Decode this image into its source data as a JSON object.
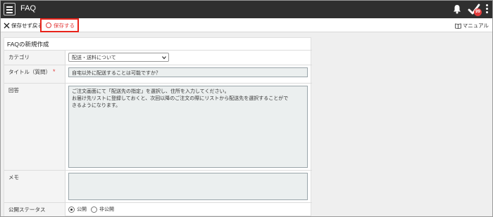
{
  "header": {
    "app_title": "FAQ",
    "badge_count": "99"
  },
  "actions": {
    "back_label": "保存せず戻る",
    "save_label": "保存する",
    "manual_label": "マニュアル"
  },
  "form": {
    "title": "FAQの新規作成",
    "fields": {
      "category": {
        "label": "カテゴリ",
        "value": "配送・送料について"
      },
      "title_question": {
        "label": "タイトル（質問）",
        "required_mark": "*",
        "value": "自宅以外に配送することは可能ですか？"
      },
      "answer": {
        "label": "回答",
        "value": "ご注文画面にて「配送先の指定」を選択し、住所を入力してください。\nお届け先リストに登録しておくと、次回以降のご注文の際にリストから配送先を選択することがで\nきるようになります。"
      },
      "memo": {
        "label": "メモ",
        "value": ""
      },
      "status": {
        "label": "公開ステータス",
        "options": [
          "公開",
          "非公開"
        ],
        "selected": "公開"
      }
    }
  },
  "colors": {
    "header_bg": "#2f2f2f",
    "save_accent": "#e23b3b",
    "badge": "#e23b3b",
    "input_bg": "#ebefef"
  },
  "icons": [
    "hamburger-icon",
    "bell-icon",
    "checkmark-icon",
    "kebab-icon",
    "close-icon",
    "circle-icon",
    "book-icon",
    "chevron-down-icon"
  ]
}
